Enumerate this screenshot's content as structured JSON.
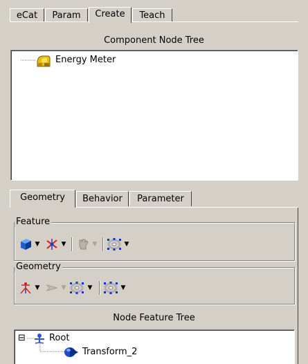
{
  "tabs": [
    {
      "label": "eCat",
      "active": false
    },
    {
      "label": "Param",
      "active": false
    },
    {
      "label": "Create",
      "active": true
    },
    {
      "label": "Teach",
      "active": false
    }
  ],
  "component_tree": {
    "title": "Component Node Tree",
    "items": [
      {
        "label": "Energy Meter",
        "icon": "energy-meter-icon"
      }
    ]
  },
  "inner_tabs": [
    {
      "label": "Geometry",
      "active": true
    },
    {
      "label": "Behavior",
      "active": false
    },
    {
      "label": "Parameter",
      "active": false
    }
  ],
  "feature_group": {
    "label": "Feature",
    "tools": [
      "box-feature-icon",
      "transform-feature-icon",
      "hand-feature-icon",
      "torus-feature-icon"
    ]
  },
  "geometry_group": {
    "label": "Geometry",
    "tools": [
      "frame-geometry-icon",
      "arrow-geometry-icon",
      "torus-geometry-icon",
      "torus-select-icon"
    ]
  },
  "node_feature_tree": {
    "title": "Node Feature Tree",
    "root_label": "Root",
    "root_expander": "⊟",
    "children": [
      {
        "label": "Transform_2",
        "icon": "transform-node-icon"
      }
    ]
  },
  "colors": {
    "background": "#d4d0c8",
    "tree_background": "#ffffff",
    "box_blue": "#1f5fc8",
    "marker_red": "#d8201c",
    "torus_select_blue": "#1030e0"
  }
}
